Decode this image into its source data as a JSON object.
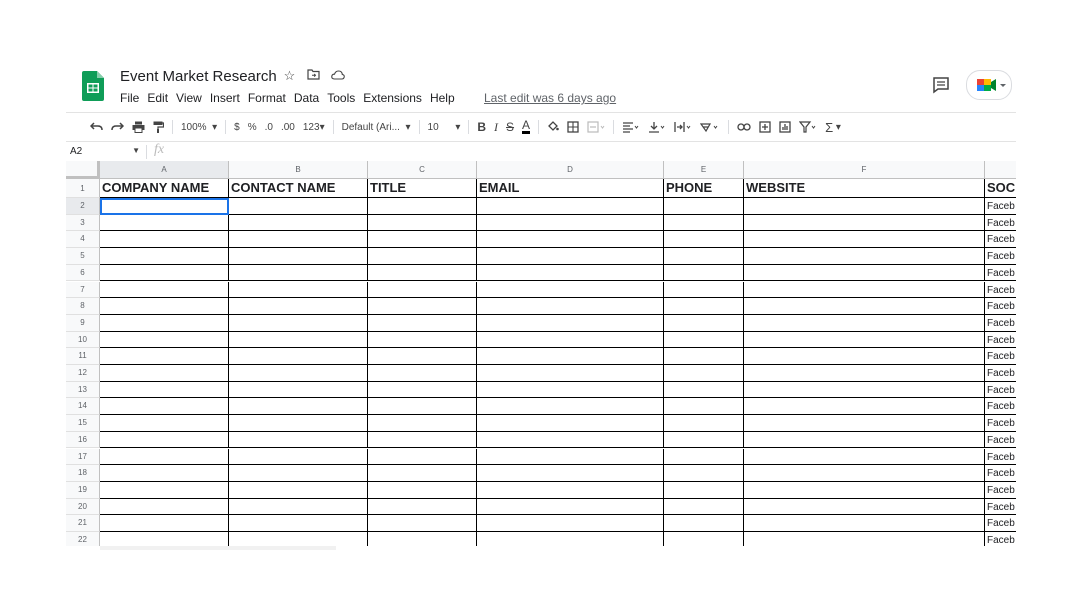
{
  "header": {
    "doc_title": "Event Market Research",
    "menu": [
      "File",
      "Edit",
      "View",
      "Insert",
      "Format",
      "Data",
      "Tools",
      "Extensions",
      "Help"
    ],
    "last_edit": "Last edit was 6 days ago",
    "icons": [
      "star-icon",
      "move-folder-icon",
      "cloud-status-icon"
    ],
    "brand_color": "#0f9d58"
  },
  "toolbar": {
    "zoom": "100%",
    "currency": "$",
    "percent": "%",
    "decrease_decimal": ".0",
    "increase_decimal": ".00",
    "more_formats": "123",
    "font": "Default (Ari...",
    "font_size": "10",
    "bold": "B",
    "italic": "I",
    "strike": "S",
    "text_color": "A",
    "sum": "Σ"
  },
  "formula_bar": {
    "name_box": "A2",
    "fx": "fx",
    "value": ""
  },
  "sheet": {
    "columns": [
      "A",
      "B",
      "C",
      "D",
      "E",
      "F",
      ""
    ],
    "headers": [
      "COMPANY NAME",
      "CONTACT NAME",
      "TITLE",
      "EMAIL",
      "PHONE",
      "WEBSITE",
      "SOC"
    ],
    "rows": [
      "1",
      "2",
      "3",
      "4",
      "5",
      "6",
      "7",
      "8",
      "9",
      "10",
      "11",
      "12",
      "13",
      "14",
      "15",
      "16",
      "17",
      "18",
      "19",
      "20",
      "21",
      "22"
    ],
    "col_g_value": "Faceb",
    "active_cell": "A2",
    "selection_color": "#1a73e8"
  }
}
